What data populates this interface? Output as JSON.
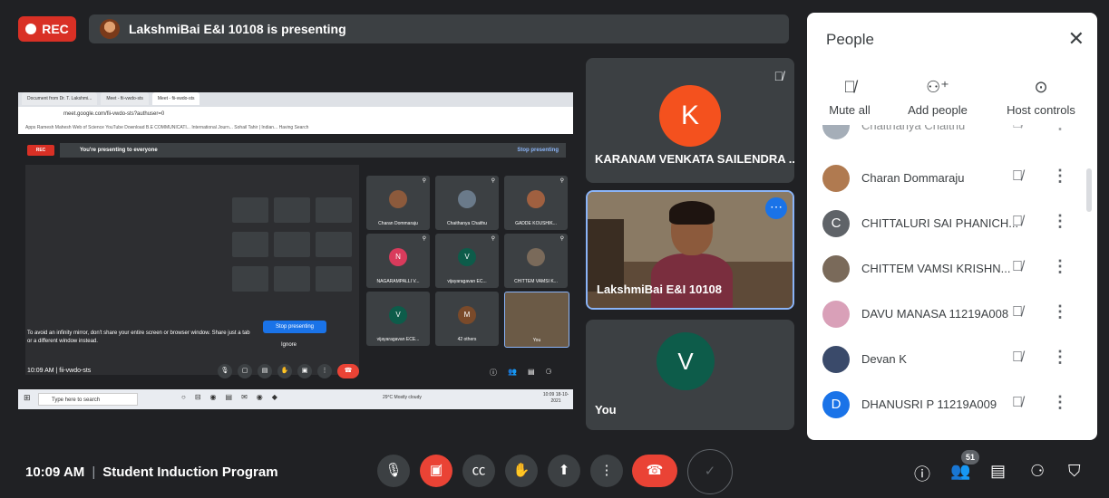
{
  "rec_label": "REC",
  "presenter_bar": {
    "text": "LakshmiBai E&I 10108 is presenting"
  },
  "shared_screen": {
    "tabs": [
      "Document from Dr. T. Lakshmi...",
      "Meet - fii-vwdo-sts",
      "Meet - fii-vwdo-sts"
    ],
    "url": "meet.google.com/fii-vwdo-sts?authuser=0",
    "bookmarks": "Apps   Ramesh Mahesh   Web of Science   YouTube Download   B.E COMMUNICATI...   International Journ...   Sohail Tahir | Indian...   Having Search",
    "rec": "REC",
    "presenting_text": "You're presenting to everyone",
    "stop_link": "Stop presenting",
    "mirror_text": "To avoid an infinity mirror, don't share your entire screen or browser window. Share just a tab or a different window instead.",
    "stop_button": "Stop presenting",
    "ignore": "Ignore",
    "time": "10:09 AM  |  fii-vwdo-sts",
    "search_placeholder": "Type here to search",
    "weather": "29°C  Mostly cloudy",
    "clock": "10:09\n18-10-2021",
    "tiles": [
      {
        "name": "Charan Dommaraju",
        "avatar": "",
        "color": "#8c5a3c"
      },
      {
        "name": "Chaithanya Chaithu",
        "avatar": "",
        "color": "#6a7a8a"
      },
      {
        "name": "GADDE KOUSHIK...",
        "avatar": "",
        "color": "#a06040"
      },
      {
        "name": "NAGARAMPALLI V...",
        "avatar": "N",
        "color": "#d93b5c"
      },
      {
        "name": "vijayaragavan EC...",
        "avatar": "V",
        "color": "#0d5c4a"
      },
      {
        "name": "CHITTEM VAMSI K...",
        "avatar": "",
        "color": "#7a6a5a"
      },
      {
        "name": "vijayaragavan ECE...",
        "avatar": "V",
        "color": "#0d5c4a"
      },
      {
        "name": "42 others",
        "avatar": "M",
        "color": "#7a4a2a"
      },
      {
        "name": "You",
        "avatar": "",
        "color": "#6b5a46"
      }
    ]
  },
  "tiles": {
    "karanam": {
      "initial": "K",
      "name": "KARANAM VENKATA SAILENDRA ...",
      "color": "#f4511e"
    },
    "lakshmibai": {
      "name": "LakshmiBai E&I 10108"
    },
    "you": {
      "initial": "V",
      "name": "You",
      "color": "#0d5c4a"
    }
  },
  "people_panel": {
    "title": "People",
    "actions": [
      {
        "label": "Mute all",
        "icon": "mic-off-icon"
      },
      {
        "label": "Add people",
        "icon": "add-person-icon"
      },
      {
        "label": "Host controls",
        "icon": "toggle-icon"
      }
    ],
    "partial_top": "Chaithanya Chaithu",
    "participants": [
      {
        "name": "Charan Dommaraju",
        "initial": "",
        "color": "#b07a50"
      },
      {
        "name": "CHITTALURI SAI PHANICH...",
        "initial": "C",
        "color": "#5f6368"
      },
      {
        "name": "CHITTEM VAMSI KRISHN...",
        "initial": "",
        "color": "#7a6a5a"
      },
      {
        "name": "DAVU MANASA 11219A008",
        "initial": "",
        "color": "#d9a0b8"
      },
      {
        "name": "Devan K",
        "initial": "",
        "color": "#3a4a6a"
      },
      {
        "name": "DHANUSRI P 11219A009",
        "initial": "D",
        "color": "#1a73e8"
      }
    ]
  },
  "bottom_bar": {
    "time": "10:09 AM",
    "meeting_name": "Student Induction Program",
    "participant_count": "51"
  }
}
